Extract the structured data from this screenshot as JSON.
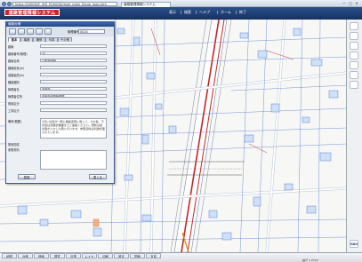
{
  "browser": {
    "url": "https://CWGIS/F_SIR_PUSIGSA/mail_main_Equip_logo.htm",
    "tab_title": "道路管理情報システム",
    "controls": [
      "—",
      "□",
      "✕"
    ]
  },
  "app": {
    "title": "道路管理情報システム",
    "menu": [
      "表示",
      "検索",
      "ヘルプ",
      "ホーム",
      "終了"
    ]
  },
  "dialog": {
    "title": "道路台帳",
    "record_label": "管理番号",
    "record_value": "0024",
    "tabs": [
      "基本",
      "構造",
      "補修",
      "写真",
      "その他"
    ],
    "rows": [
      {
        "label": "路線",
        "value": ""
      },
      {
        "label": "路線番号(管理)",
        "value": "45"
      },
      {
        "label": "路線名称",
        "value": "江東新道線"
      },
      {
        "label": "路線延長(m)",
        "value": ""
      },
      {
        "label": "道路幅員(m)",
        "value": ""
      },
      {
        "label": "舗装種別",
        "value": ""
      },
      {
        "label": "管理者名",
        "value": "市役所"
      },
      {
        "label": "管理者住所",
        "value": "市役所道路管理課"
      },
      {
        "label": "費用区分",
        "value": ""
      },
      {
        "label": "工事区分",
        "value": ""
      }
    ],
    "memo_label": "備考(概要)",
    "memo_text": "1月に位置が一部に路線変更に関して、その他、不具合は道路管理課までご連絡ください。更新は担当者が入力した際に行います。参照資料は別途管理されています。",
    "memo2_label": "関係図書",
    "memo2_sub": "参照資料",
    "buttons": {
      "ok": "登録",
      "close": "閉じる"
    }
  },
  "bottom_tabs": [
    "地図",
    "台帳",
    "検索",
    "属性",
    "計測",
    "レイヤ",
    "印刷",
    "設定",
    "図面",
    "写真"
  ],
  "status": "縮尺 1:2500",
  "logo_mark": "GAU",
  "colors": {
    "header": "#1f3d73",
    "logo": "#c8262d",
    "road": "#d02020",
    "map_lines": "#3b6bd1"
  }
}
